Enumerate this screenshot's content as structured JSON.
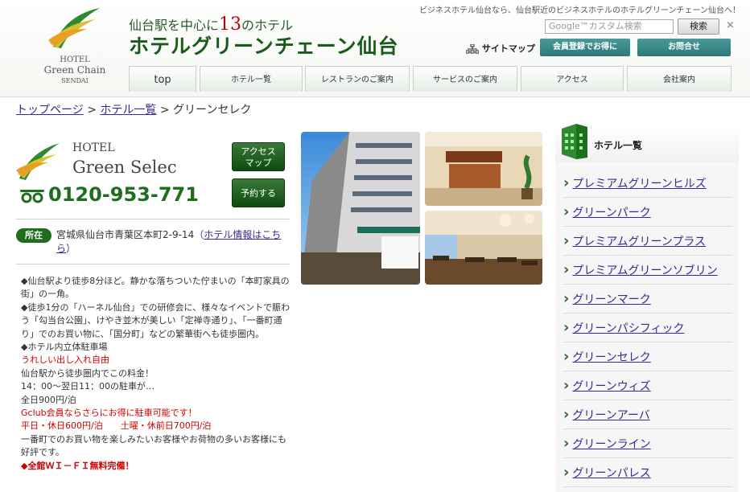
{
  "header": {
    "tagline": "ビジネスホテル仙台なら、仙台駅近のビジネスホテルのホテルグリーンチェーン仙台へ！",
    "logo_lines": [
      "HOTEL",
      "Green Chain",
      "SENDAI"
    ],
    "title_sub_pre": "仙台駅を中心に",
    "title_sub_num": "13",
    "title_sub_post": "のホテル",
    "title_main": "ホテルグリーンチェーン仙台",
    "search_placeholder": "Google™カスタム検索",
    "search_button": "検索",
    "search_clear": "×",
    "sitemap": "サイトマップ",
    "member_button": "会員登録でお得に",
    "contact_button": "お問合せ"
  },
  "nav": [
    "top",
    "ホテル一覧",
    "レストランのご案内",
    "サービスのご案内",
    "アクセス",
    "会社案内"
  ],
  "breadcrumb": {
    "home": "トップページ",
    "sep1": ">",
    "hotels": "ホテル一覧",
    "sep2": ">",
    "current": "グリーンセレク"
  },
  "hotel": {
    "name_line1": "HOTEL",
    "name_line2": "Green Selec",
    "phone": "0120-953-771",
    "access_button": "アクセス\nマップ",
    "reserve_button": "予約する",
    "address_label": "所在",
    "address": "宮城県仙台市青葉区本町2-9-14",
    "address_link": "ホテル情報はこちら",
    "address_paren_open": "（",
    "address_paren_close": "）"
  },
  "description": [
    {
      "text": "◆仙台駅より徒歩8分ほど。静かな落ちついた佇まいの「本町家具の街」の一角。",
      "color": "normal"
    },
    {
      "text": "◆徒歩1分の「ハーネル仙台」での研修会に、様々なイベントで賑わう「勾当台公園」、けやき並木が美しい「定禅寺通り」、「一番町通り」でのお買い物に、「国分町」などの繁華街へも徒歩圏内。",
      "color": "normal"
    },
    {
      "text": "◆ホテル内立体駐車場",
      "color": "normal"
    },
    {
      "text": "うれしい出し入れ自由",
      "color": "red"
    },
    {
      "text": "仙台駅から徒歩圏内でこの料金！",
      "color": "normal"
    },
    {
      "text": "14：00～翌日11：00の駐車が…",
      "color": "normal"
    },
    {
      "text": "全日900円/泊",
      "color": "normal"
    },
    {
      "text": "Gclub会員ならさらにお得に駐車可能です！",
      "color": "red"
    },
    {
      "text": "平日・休日600円/泊　　土曜・休前日700円/泊",
      "color": "red"
    },
    {
      "text": "一番町でのお買い物を楽しみたいお客様やお荷物の多いお客様にも好評です。",
      "color": "normal"
    },
    {
      "text": "◆全館ＷＩ－ＦＩ無料完備！",
      "color": "red-bold"
    }
  ],
  "sidebar": {
    "title": "ホテル一覧",
    "items": [
      "プレミアムグリーンヒルズ",
      "グリーンパーク",
      "プレミアムグリーンプラス",
      "プレミアムグリーンソブリン",
      "グリーンマーク",
      "グリーンパシフィック",
      "グリーンセレク",
      "グリーンウィズ",
      "グリーンアーバ",
      "グリーンライン",
      "グリーンパレス"
    ]
  },
  "colors": {
    "brand_green": "#1e6e1e",
    "link": "#3a2a8f",
    "accent_red": "#d00000",
    "teal_button": "#2e7878"
  }
}
